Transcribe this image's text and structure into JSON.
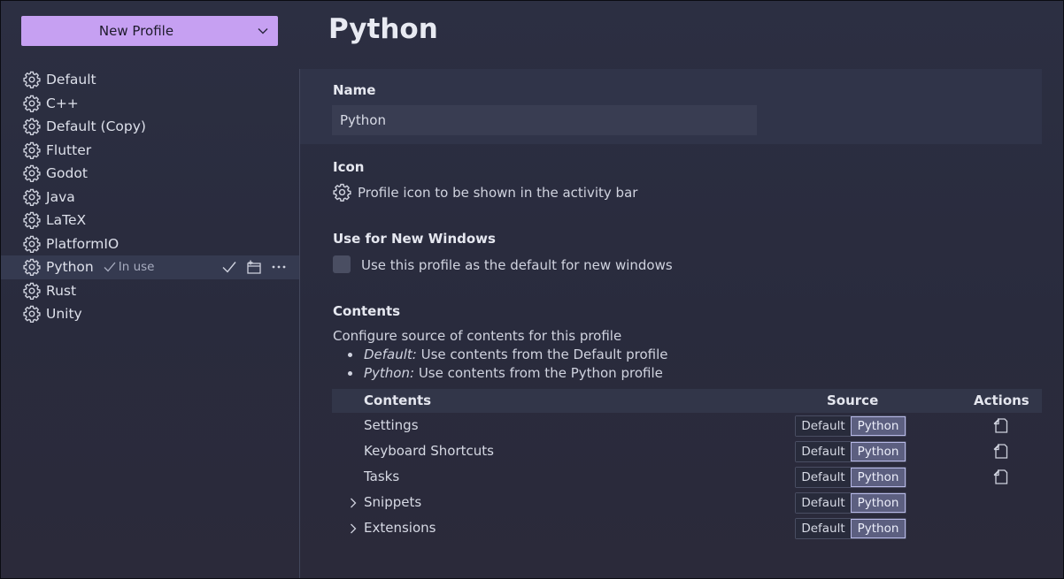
{
  "sidebar": {
    "new_profile_label": "New Profile",
    "profiles": [
      {
        "label": "Default"
      },
      {
        "label": "C++"
      },
      {
        "label": "Default (Copy)"
      },
      {
        "label": "Flutter"
      },
      {
        "label": "Godot"
      },
      {
        "label": "Java"
      },
      {
        "label": "LaTeX"
      },
      {
        "label": "PlatformIO"
      },
      {
        "label": "Python",
        "active": true,
        "status": "In use"
      },
      {
        "label": "Rust"
      },
      {
        "label": "Unity"
      }
    ],
    "active_actions": [
      "check-icon",
      "new-window-icon",
      "more-icon"
    ]
  },
  "main": {
    "title": "Python",
    "name": {
      "label": "Name",
      "value": "Python"
    },
    "icon": {
      "label": "Icon",
      "description": "Profile icon to be shown in the activity bar"
    },
    "new_windows": {
      "label": "Use for New Windows",
      "description": "Use this profile as the default for new windows",
      "checked": false
    },
    "contents": {
      "label": "Contents",
      "description": "Configure source of contents for this profile",
      "bullets": [
        {
          "term": "Default:",
          "text": " Use contents from the Default profile"
        },
        {
          "term": "Python:",
          "text": " Use contents from the Python profile"
        }
      ],
      "columns": {
        "contents": "Contents",
        "source": "Source",
        "actions": "Actions"
      },
      "rows": [
        {
          "label": "Settings",
          "expandable": false,
          "source_options": [
            "Default",
            "Python"
          ],
          "selected": "Python",
          "has_action": true
        },
        {
          "label": "Keyboard Shortcuts",
          "expandable": false,
          "source_options": [
            "Default",
            "Python"
          ],
          "selected": "Python",
          "has_action": true
        },
        {
          "label": "Tasks",
          "expandable": false,
          "source_options": [
            "Default",
            "Python"
          ],
          "selected": "Python",
          "has_action": true
        },
        {
          "label": "Snippets",
          "expandable": true,
          "source_options": [
            "Default",
            "Python"
          ],
          "selected": "Python",
          "has_action": false
        },
        {
          "label": "Extensions",
          "expandable": true,
          "source_options": [
            "Default",
            "Python"
          ],
          "selected": "Python",
          "has_action": false
        }
      ]
    }
  },
  "colors": {
    "accent": "#c6a0f2",
    "background": "#2a2d40",
    "selected_segment": "#5c5f80"
  }
}
